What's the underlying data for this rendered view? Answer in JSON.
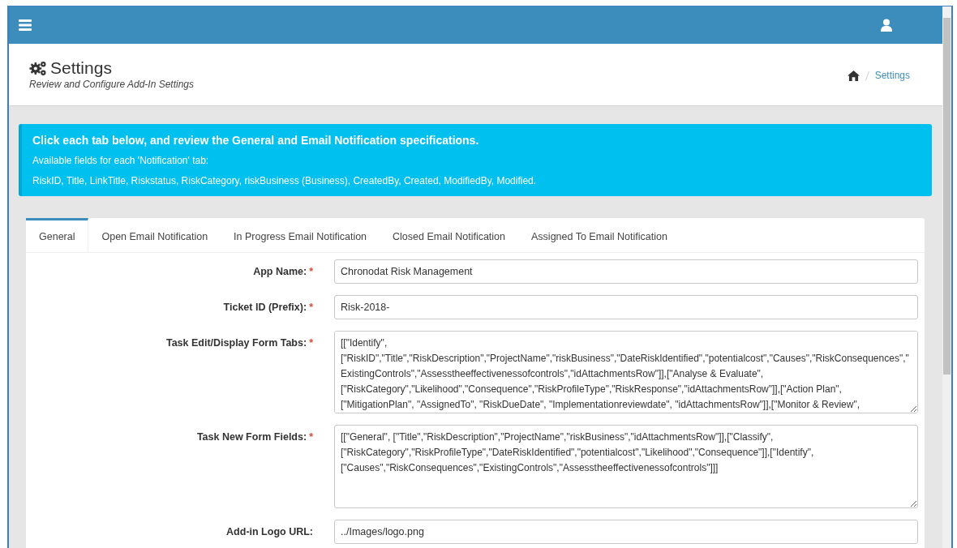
{
  "header": {
    "title": "Settings",
    "subtitle": "Review and Configure Add-In Settings"
  },
  "breadcrumb": [
    {
      "label": "Settings"
    }
  ],
  "alert": {
    "heading": "Click each tab below, and review the General and Email Notification specifications.",
    "lines": [
      "Available fields for each 'Notification' tab:",
      "RiskID, Title, LinkTitle, Riskstatus, RiskCategory, riskBusiness (Business), CreatedBy, Created, ModifiedBy, Modified."
    ]
  },
  "tabs": [
    {
      "label": "General",
      "selected": true
    },
    {
      "label": "Open Email Notification",
      "selected": false
    },
    {
      "label": "In Progress Email Notification",
      "selected": false
    },
    {
      "label": "Closed Email Notification",
      "selected": false
    },
    {
      "label": "Assigned To Email Notification",
      "selected": false
    }
  ],
  "fields": [
    {
      "label": "App Name:",
      "mark": "*",
      "kind": "input",
      "value": "Chronodat Risk Management"
    },
    {
      "label": "Ticket ID (Prefix):",
      "mark": "*",
      "kind": "input",
      "value": "Risk-2018-"
    },
    {
      "label": "Task Edit/Display Form Tabs:",
      "mark": "*",
      "kind": "textarea",
      "value": "[[\"Identify\",\n[\"RiskID\",\"Title\",\"RiskDescription\",\"ProjectName\",\"riskBusiness\",\"DateRiskIdentified\",\"potentialcost\",\"Causes\",\"RiskConsequences\",\"ExistingControls\",\"Assesstheeffectivenessofcontrols\",\"idAttachmentsRow\"]],[\"Analyse & Evaluate\",\n[\"RiskCategory\",\"Likelihood\",\"Consequence\",\"RiskProfileType\",\"RiskResponse\",\"idAttachmentsRow\"]],[\"Action Plan\",\n[\"MitigationPlan\", \"AssignedTo\", \"RiskDueDate\", \"Implementationreviewdate\", \"idAttachmentsRow\"]],[\"Monitor & Review\","
    },
    {
      "label": "Task New Form Fields:",
      "mark": "*",
      "kind": "textarea_tall",
      "value": "[[\"General\", [\"Title\",\"RiskDescription\",\"ProjectName\",\"riskBusiness\",\"idAttachmentsRow\"]],[\"Classify\",\n[\"RiskCategory\",\"RiskProfileType\",\"DateRiskIdentified\",\"potentialcost\",\"Likelihood\",\"Consequence\"]],[\"Identify\",\n[\"Causes\",\"RiskConsequences\",\"ExistingControls\",\"Assesstheeffectivenessofcontrols\"]]]"
    },
    {
      "label": "Add-in Logo URL:",
      "kind": "input",
      "value": "../Images/logo.png"
    }
  ]
}
